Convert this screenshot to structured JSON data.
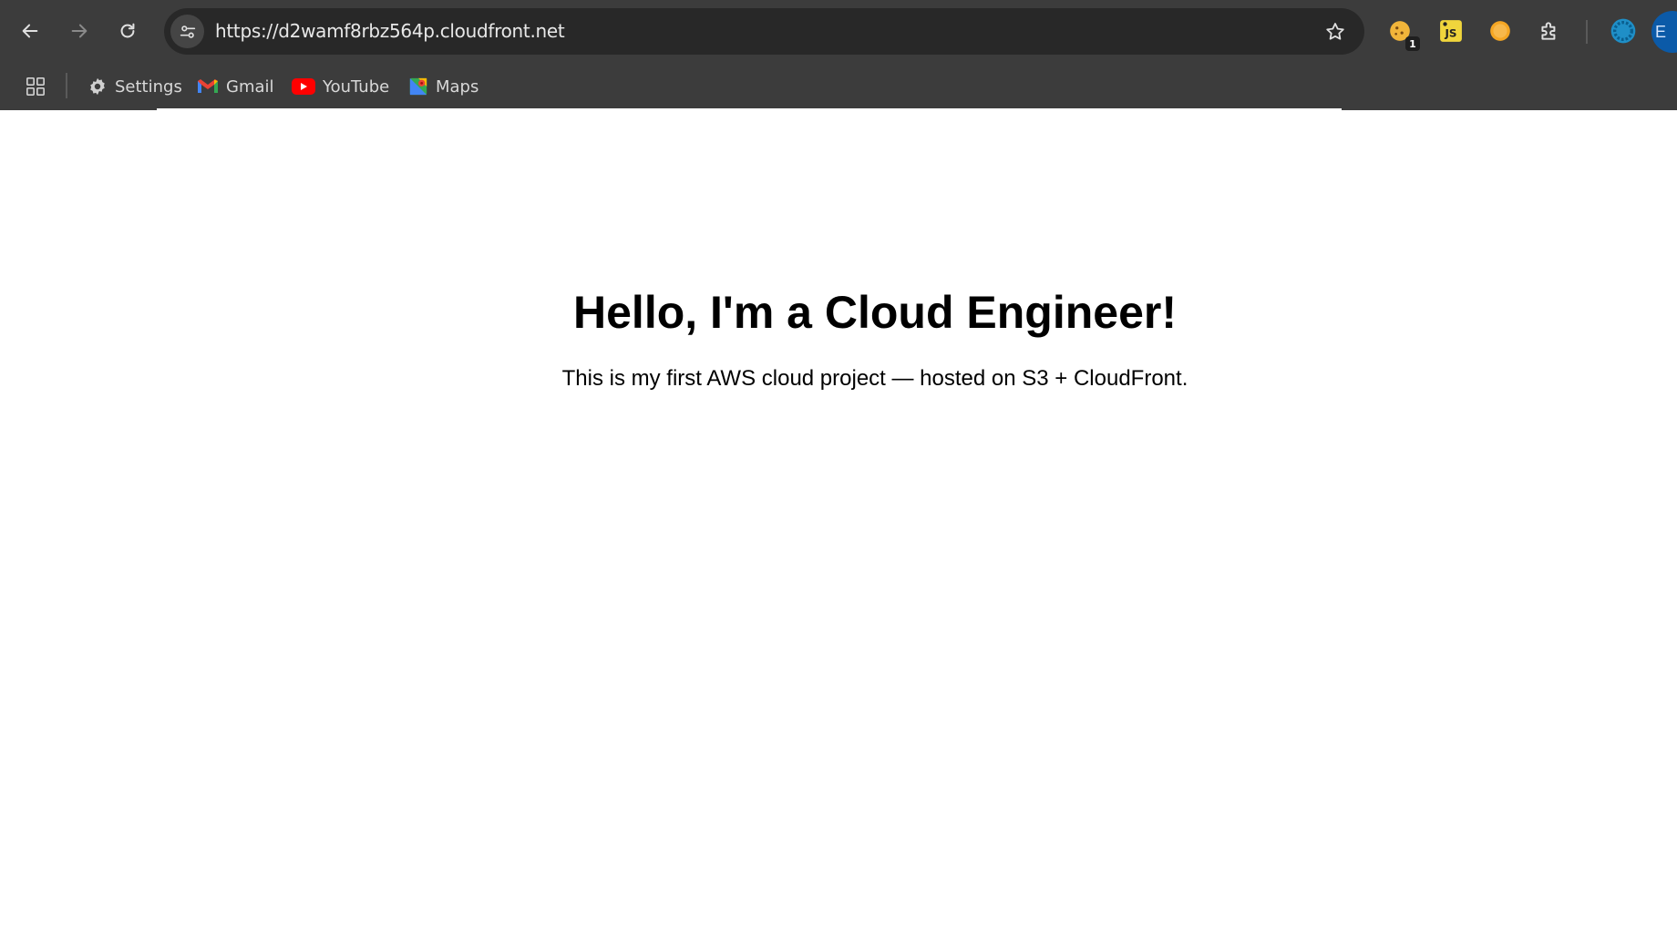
{
  "browser": {
    "url": "https://d2wamf8rbz564p.cloudfront.net",
    "extension_badge": "1",
    "profile_initial": "E",
    "bookmarks": [
      {
        "label": "Settings",
        "icon": "gear-icon"
      },
      {
        "label": "Gmail",
        "icon": "gmail-icon"
      },
      {
        "label": "YouTube",
        "icon": "youtube-icon"
      },
      {
        "label": "Maps",
        "icon": "maps-icon"
      }
    ],
    "colors": {
      "chrome_bg": "#3c3c3c",
      "omnibox_bg": "#282828",
      "text": "#e8e8e8"
    }
  },
  "page": {
    "heading": "Hello, I'm a Cloud Engineer!",
    "subtext": "This is my first AWS cloud project — hosted on S3 + CloudFront.",
    "background": "#ffffff"
  }
}
